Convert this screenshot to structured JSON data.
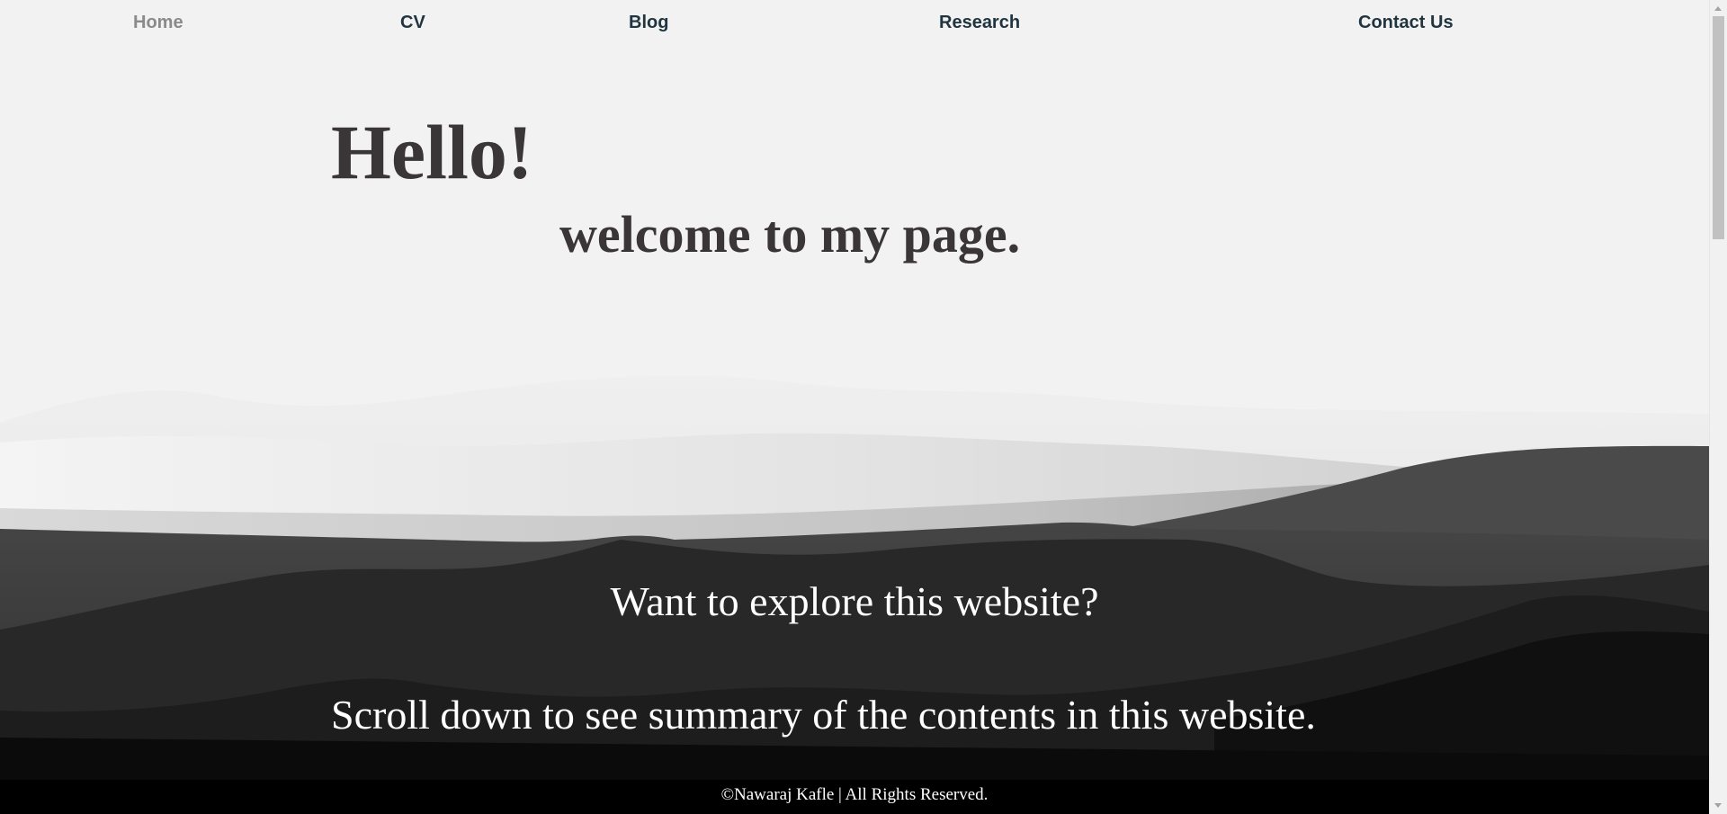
{
  "nav": {
    "items": [
      {
        "label": "Home",
        "active": true
      },
      {
        "label": "CV",
        "active": false
      },
      {
        "label": "Blog",
        "active": false
      },
      {
        "label": "Research",
        "active": false
      },
      {
        "label": "Contact Us",
        "active": false
      }
    ]
  },
  "hero": {
    "greeting": "Hello!",
    "welcome": "welcome to my page."
  },
  "explore": {
    "question": "Want to explore this website?",
    "hint": "Scroll down to see summary of the contents in this website."
  },
  "footer": {
    "copyright": "©Nawaraj Kafle | All Rights Reserved."
  },
  "colors": {
    "background": "#f2f2f2",
    "heading": "#3a3536",
    "nav_link": "#213540",
    "nav_active": "#8a8a8a",
    "footer_bg": "#000000"
  }
}
